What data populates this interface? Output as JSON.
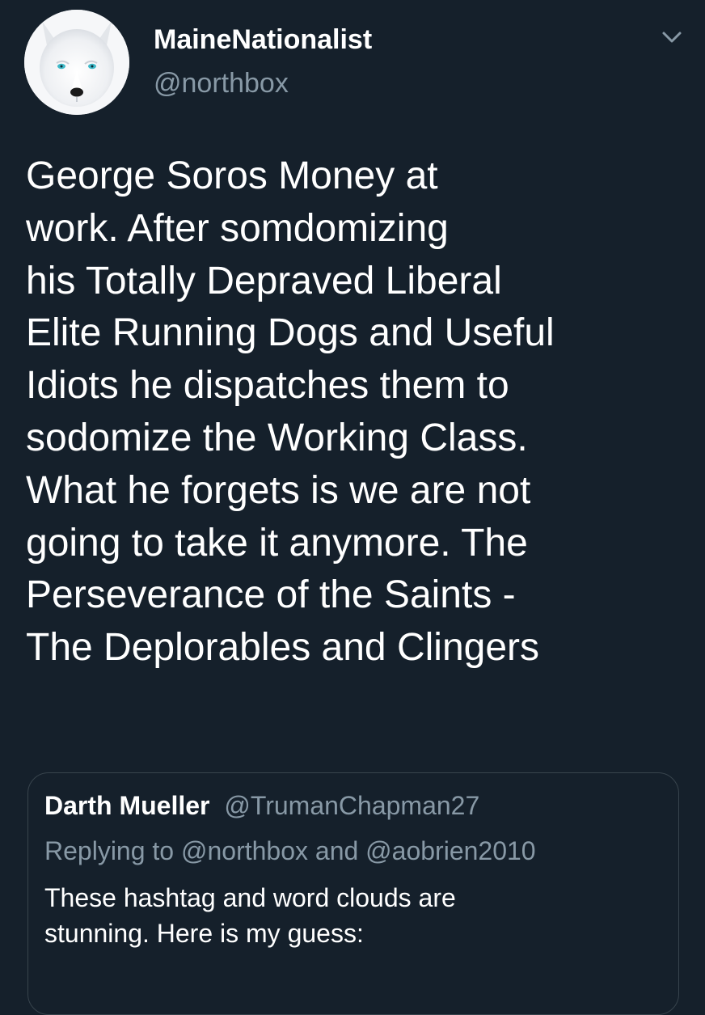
{
  "tweet": {
    "author": {
      "name": "MaineNationalist",
      "handle": "@northbox",
      "avatar_icon": "white-wolf-avatar"
    },
    "menu_icon": "chevron-down-icon",
    "text": "George Soros Money at\nwork.  After somdomizing\nhis Totally Depraved Liberal\nElite Running Dogs and Useful\nIdiots he dispatches them to\nsodomize the Working Class.\nWhat he forgets is we are not\ngoing to take it anymore. The\nPerseverance of the Saints -\nThe Deplorables and Clingers"
  },
  "quoted_tweet": {
    "author_name": "Darth Mueller",
    "author_handle": "@TrumanChapman27",
    "reply_context": "Replying to @northbox and @aobrien2010",
    "text": "These hashtag and word clouds are\nstunning. Here is my guess:"
  },
  "colors": {
    "background": "#15202b",
    "primary_text": "#ffffff",
    "secondary_text": "#8899a6",
    "border": "#38444d"
  }
}
